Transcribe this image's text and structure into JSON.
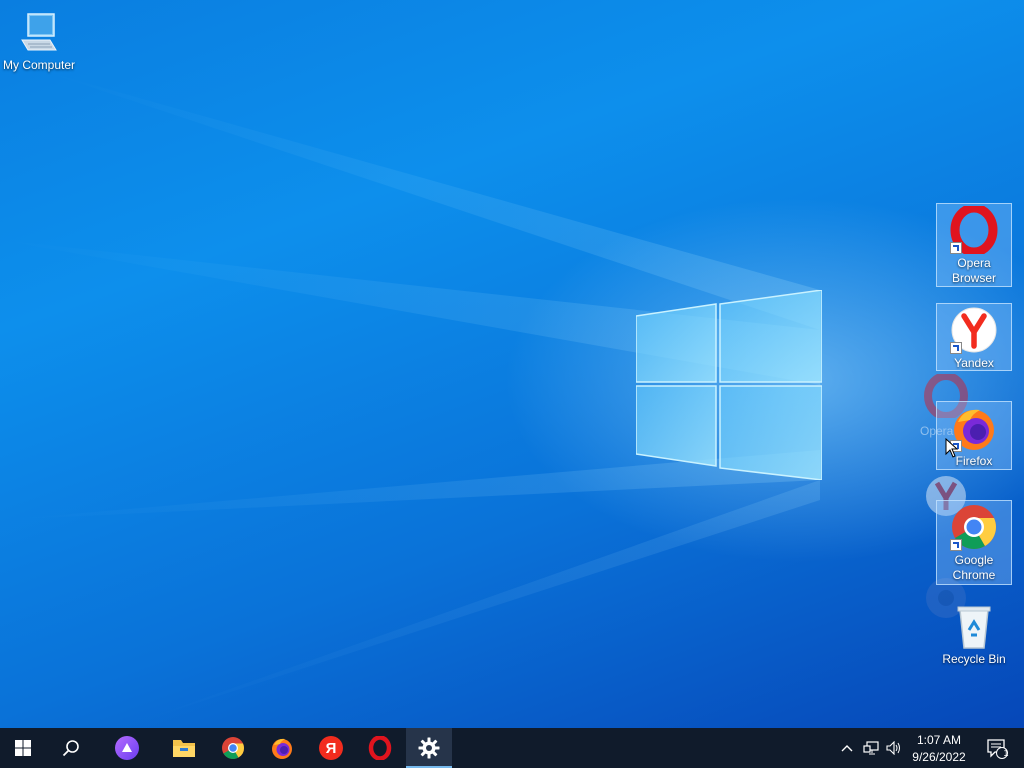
{
  "desktop": {
    "icons": [
      {
        "label": "My Computer"
      },
      {
        "label_1": "Opera",
        "label_2": "Browser"
      },
      {
        "label": "Yandex"
      },
      {
        "label": "Firefox"
      },
      {
        "label_1": "Google",
        "label_2": "Chrome"
      },
      {
        "label": "Recycle Bin"
      }
    ],
    "ghost_label": "Opera"
  },
  "taskbar": {
    "apps": [
      "start-icon",
      "search-icon",
      "alice-icon",
      "file-explorer-icon",
      "chrome-icon",
      "firefox-icon",
      "yandex-icon",
      "opera-icon",
      "settings-icon"
    ],
    "yandex_glyph": "Я",
    "clock": {
      "time": "1:07 AM",
      "date": "9/26/2022"
    },
    "notifications_count": "1"
  },
  "colors": {
    "taskbar_bg": "#101b2b",
    "accent": "#76b9ed",
    "opera_red": "#e0141e",
    "yandex_red": "#f22c1e"
  }
}
